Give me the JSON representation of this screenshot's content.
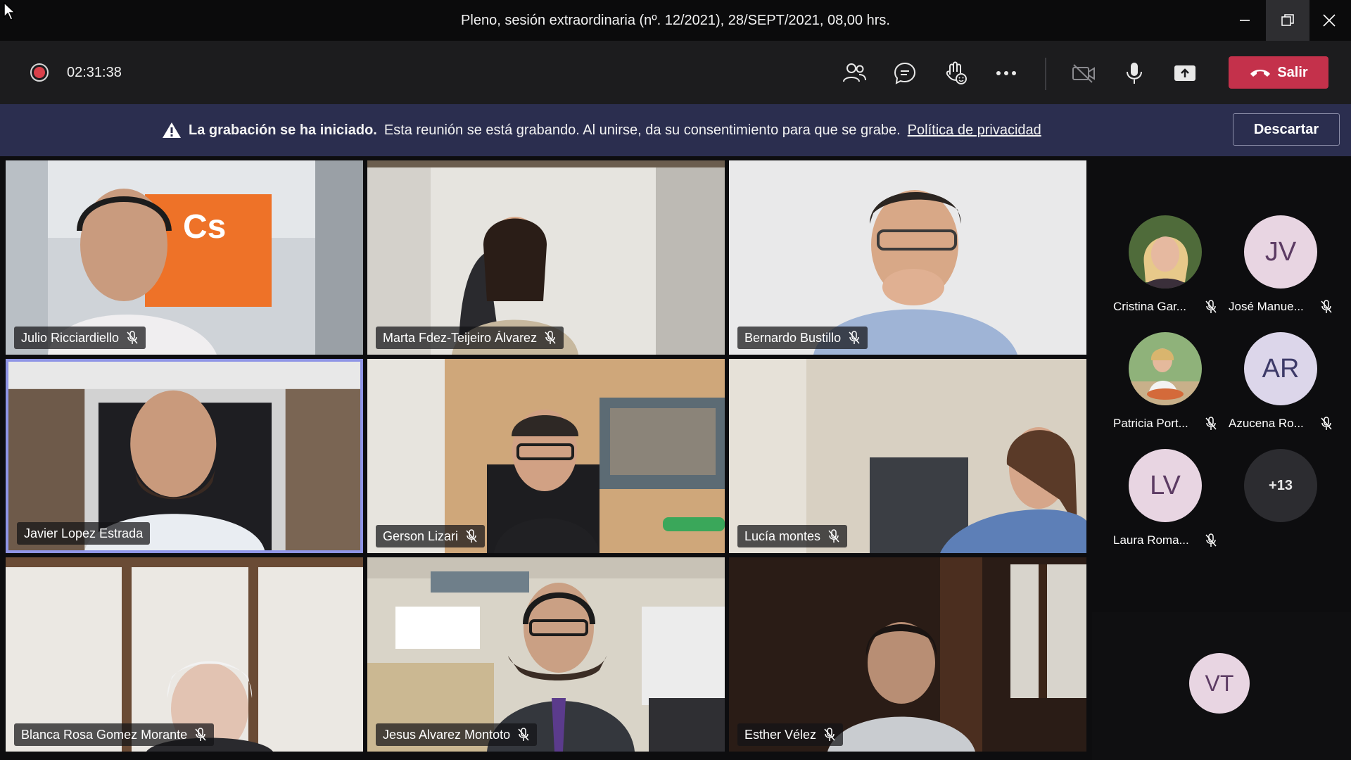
{
  "window": {
    "title": "Pleno, sesión extraordinaria (nº. 12/2021), 28/SEPT/2021, 08,00 hrs."
  },
  "toolbar": {
    "timer": "02:31:38",
    "leave_label": "Salir",
    "icons": [
      "participants-icon",
      "chat-icon",
      "reactions-icon",
      "more-options-icon",
      "camera-off-icon",
      "microphone-icon",
      "share-screen-icon"
    ]
  },
  "banner": {
    "bold_text": "La grabación se ha iniciado.",
    "text": "Esta reunión se está grabando. Al unirse, da su consentimiento para que se grabe.",
    "link": "Política de privacidad",
    "dismiss_label": "Descartar"
  },
  "tiles": [
    {
      "name": "Julio Ricciardiello",
      "muted": true
    },
    {
      "name": "Marta Fdez-Teijeiro Álvarez",
      "muted": true
    },
    {
      "name": "Bernardo Bustillo",
      "muted": true
    },
    {
      "name": "Javier Lopez Estrada",
      "muted": false,
      "active": true
    },
    {
      "name": "Gerson Lizari",
      "muted": true
    },
    {
      "name": "Lucía montes",
      "muted": true
    },
    {
      "name": "Blanca Rosa Gomez Morante",
      "muted": true
    },
    {
      "name": "Jesus Alvarez Montoto",
      "muted": true
    },
    {
      "name": "Esther Vélez",
      "muted": true
    }
  ],
  "roster": [
    {
      "name": "Cristina Gar...",
      "initials": "",
      "photo": true
    },
    {
      "name": "José Manue...",
      "initials": "JV"
    },
    {
      "name": "Patricia Port...",
      "initials": "",
      "photo": true
    },
    {
      "name": "Azucena Ro...",
      "initials": "AR"
    },
    {
      "name": "Laura Roma...",
      "initials": "LV"
    },
    {
      "name": "",
      "initials": "+13"
    }
  ],
  "self_view": {
    "initials": "VT"
  }
}
